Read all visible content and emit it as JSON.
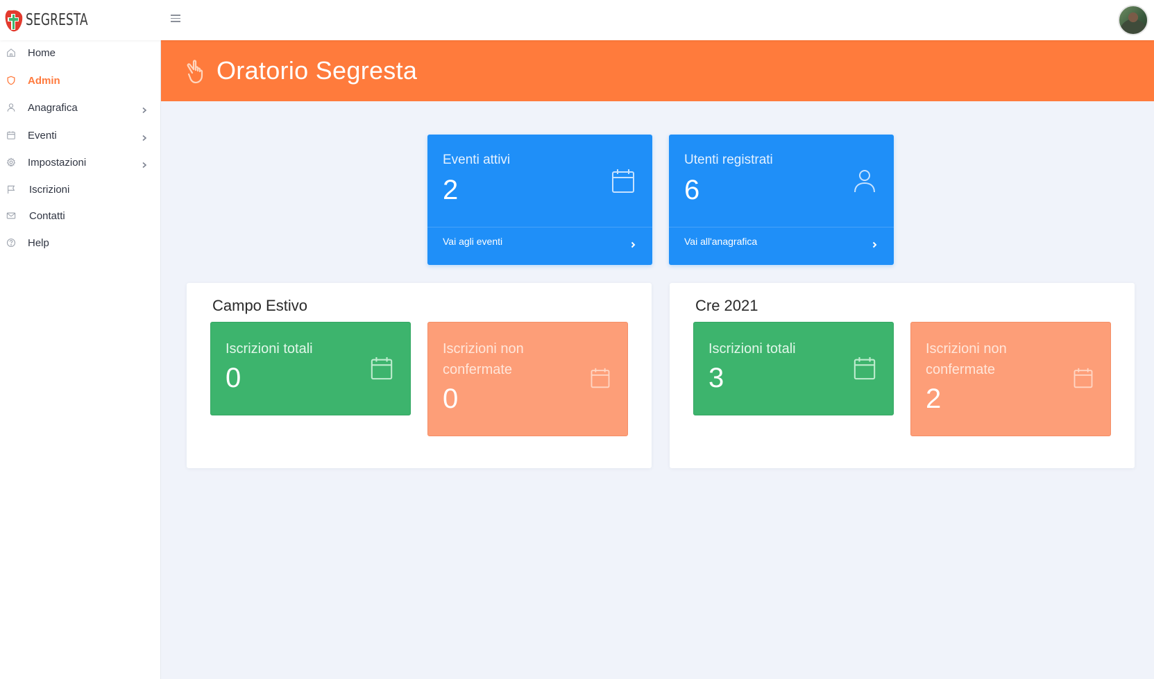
{
  "app": {
    "logo_text": "SEGRESTA"
  },
  "sidebar": {
    "items": [
      {
        "label": "Home",
        "icon": "home-icon"
      },
      {
        "label": "Admin",
        "icon": "shield-icon",
        "active": true
      },
      {
        "label": "Anagrafica",
        "icon": "user-icon",
        "expandable": true
      },
      {
        "label": "Eventi",
        "icon": "calendar-icon",
        "expandable": true
      },
      {
        "label": "Impostazioni",
        "icon": "gear-icon",
        "expandable": true
      },
      {
        "label": "Iscrizioni",
        "icon": "flag-icon"
      },
      {
        "label": "Contatti",
        "icon": "mail-icon"
      },
      {
        "label": "Help",
        "icon": "help-icon"
      }
    ]
  },
  "banner": {
    "title": "Oratorio Segresta",
    "icon": "hand-icon"
  },
  "stats": [
    {
      "label": "Eventi attivi",
      "value": "2",
      "link": "Vai agli eventi",
      "icon": "calendar-icon"
    },
    {
      "label": "Utenti registrati",
      "value": "6",
      "link": "Vai all'anagrafica",
      "icon": "user-icon"
    }
  ],
  "events": [
    {
      "title": "Campo Estivo",
      "total_label": "Iscrizioni totali",
      "total_value": "0",
      "pending_label": "Iscrizioni non confermate",
      "pending_value": "0"
    },
    {
      "title": "Cre 2021",
      "total_label": "Iscrizioni totali",
      "total_value": "3",
      "pending_label": "Iscrizioni non confermate",
      "pending_value": "2"
    }
  ],
  "colors": {
    "accent": "#ff7b3c",
    "stat_blue": "#1f8ff8",
    "green": "#3db46d",
    "peach": "#fd9e78",
    "background": "#f0f3fa"
  }
}
